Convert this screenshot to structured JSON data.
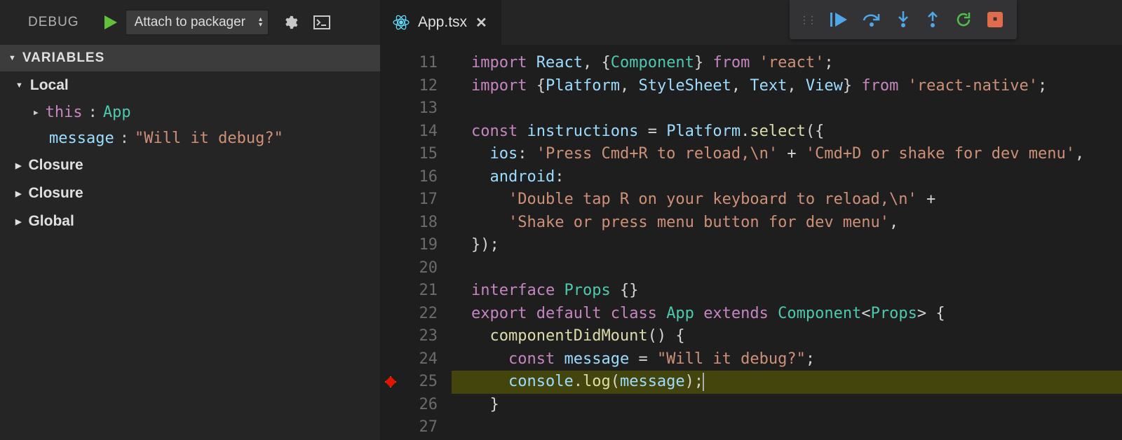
{
  "sidebar": {
    "header_label": "DEBUG",
    "start_icon": "play-icon",
    "config_selected": "Attach to packager",
    "gear_icon": "gear-icon",
    "console_icon": "debug-console-icon",
    "section_variables": "VARIABLES",
    "scopes": [
      {
        "name": "Local",
        "expanded": true
      },
      {
        "name": "Closure",
        "expanded": false
      },
      {
        "name": "Closure",
        "expanded": false
      },
      {
        "name": "Global",
        "expanded": false
      }
    ],
    "local_vars": [
      {
        "name": "this",
        "value": "App",
        "kind": "this"
      },
      {
        "name": "message",
        "value": "\"Will it debug?\"",
        "kind": "string"
      }
    ]
  },
  "editor": {
    "tab": {
      "icon": "react-icon",
      "filename": "App.tsx"
    },
    "debug_toolbar": {
      "continue": "continue-icon",
      "step_over": "step-over-icon",
      "step_into": "step-into-icon",
      "step_out": "step-out-icon",
      "restart": "restart-icon",
      "stop": "stop-icon"
    },
    "first_line_number": 11,
    "breakpoint_line": 25,
    "highlighted_line": 25,
    "lines": [
      {
        "n": 11,
        "t": [
          [
            "kw",
            "import"
          ],
          [
            "pl",
            " "
          ],
          [
            "id",
            "React"
          ],
          [
            "pl",
            ", {"
          ],
          [
            "ty",
            "Component"
          ],
          [
            "pl",
            "} "
          ],
          [
            "kw",
            "from"
          ],
          [
            "pl",
            " "
          ],
          [
            "st",
            "'react'"
          ],
          [
            "pl",
            ";"
          ]
        ]
      },
      {
        "n": 12,
        "t": [
          [
            "kw",
            "import"
          ],
          [
            "pl",
            " {"
          ],
          [
            "id",
            "Platform"
          ],
          [
            "pl",
            ", "
          ],
          [
            "id",
            "StyleSheet"
          ],
          [
            "pl",
            ", "
          ],
          [
            "id",
            "Text"
          ],
          [
            "pl",
            ", "
          ],
          [
            "id",
            "View"
          ],
          [
            "pl",
            "} "
          ],
          [
            "kw",
            "from"
          ],
          [
            "pl",
            " "
          ],
          [
            "st",
            "'react-native'"
          ],
          [
            "pl",
            ";"
          ]
        ]
      },
      {
        "n": 13,
        "t": [
          [
            "pl",
            ""
          ]
        ]
      },
      {
        "n": 14,
        "t": [
          [
            "kw",
            "const"
          ],
          [
            "pl",
            " "
          ],
          [
            "id",
            "instructions"
          ],
          [
            "pl",
            " "
          ],
          [
            "op",
            "="
          ],
          [
            "pl",
            " "
          ],
          [
            "id",
            "Platform"
          ],
          [
            "pl",
            "."
          ],
          [
            "fn",
            "select"
          ],
          [
            "pl",
            "({"
          ]
        ]
      },
      {
        "n": 15,
        "t": [
          [
            "pl",
            "  "
          ],
          [
            "at",
            "ios"
          ],
          [
            "pl",
            ": "
          ],
          [
            "st",
            "'Press Cmd+R to reload,\\n'"
          ],
          [
            "pl",
            " "
          ],
          [
            "op",
            "+"
          ],
          [
            "pl",
            " "
          ],
          [
            "st",
            "'Cmd+D or shake for dev menu'"
          ],
          [
            "pl",
            ","
          ]
        ]
      },
      {
        "n": 16,
        "t": [
          [
            "pl",
            "  "
          ],
          [
            "at",
            "android"
          ],
          [
            "pl",
            ":"
          ]
        ]
      },
      {
        "n": 17,
        "t": [
          [
            "pl",
            "    "
          ],
          [
            "st",
            "'Double tap R on your keyboard to reload,\\n'"
          ],
          [
            "pl",
            " "
          ],
          [
            "op",
            "+"
          ]
        ]
      },
      {
        "n": 18,
        "t": [
          [
            "pl",
            "    "
          ],
          [
            "st",
            "'Shake or press menu button for dev menu'"
          ],
          [
            "pl",
            ","
          ]
        ]
      },
      {
        "n": 19,
        "t": [
          [
            "pl",
            "});"
          ]
        ]
      },
      {
        "n": 20,
        "t": [
          [
            "pl",
            ""
          ]
        ]
      },
      {
        "n": 21,
        "t": [
          [
            "kw",
            "interface"
          ],
          [
            "pl",
            " "
          ],
          [
            "ty",
            "Props"
          ],
          [
            "pl",
            " {}"
          ]
        ]
      },
      {
        "n": 22,
        "t": [
          [
            "kw",
            "export"
          ],
          [
            "pl",
            " "
          ],
          [
            "kw",
            "default"
          ],
          [
            "pl",
            " "
          ],
          [
            "kw",
            "class"
          ],
          [
            "pl",
            " "
          ],
          [
            "ty",
            "App"
          ],
          [
            "pl",
            " "
          ],
          [
            "kw",
            "extends"
          ],
          [
            "pl",
            " "
          ],
          [
            "ty",
            "Component"
          ],
          [
            "pl",
            "<"
          ],
          [
            "ty",
            "Props"
          ],
          [
            "pl",
            "> {"
          ]
        ]
      },
      {
        "n": 23,
        "t": [
          [
            "pl",
            "  "
          ],
          [
            "fn",
            "componentDidMount"
          ],
          [
            "pl",
            "() {"
          ]
        ]
      },
      {
        "n": 24,
        "t": [
          [
            "pl",
            "    "
          ],
          [
            "kw",
            "const"
          ],
          [
            "pl",
            " "
          ],
          [
            "id",
            "message"
          ],
          [
            "pl",
            " "
          ],
          [
            "op",
            "="
          ],
          [
            "pl",
            " "
          ],
          [
            "st",
            "\"Will it debug?\""
          ],
          [
            "pl",
            ";"
          ]
        ]
      },
      {
        "n": 25,
        "t": [
          [
            "pl",
            "    "
          ],
          [
            "id",
            "console"
          ],
          [
            "pl",
            "."
          ],
          [
            "fn",
            "log"
          ],
          [
            "pl",
            "("
          ],
          [
            "id",
            "message"
          ],
          [
            "pl",
            ");"
          ]
        ],
        "hl": true,
        "cursor": true
      },
      {
        "n": 26,
        "t": [
          [
            "pl",
            "  }"
          ]
        ]
      },
      {
        "n": 27,
        "t": [
          [
            "pl",
            ""
          ]
        ]
      }
    ]
  }
}
